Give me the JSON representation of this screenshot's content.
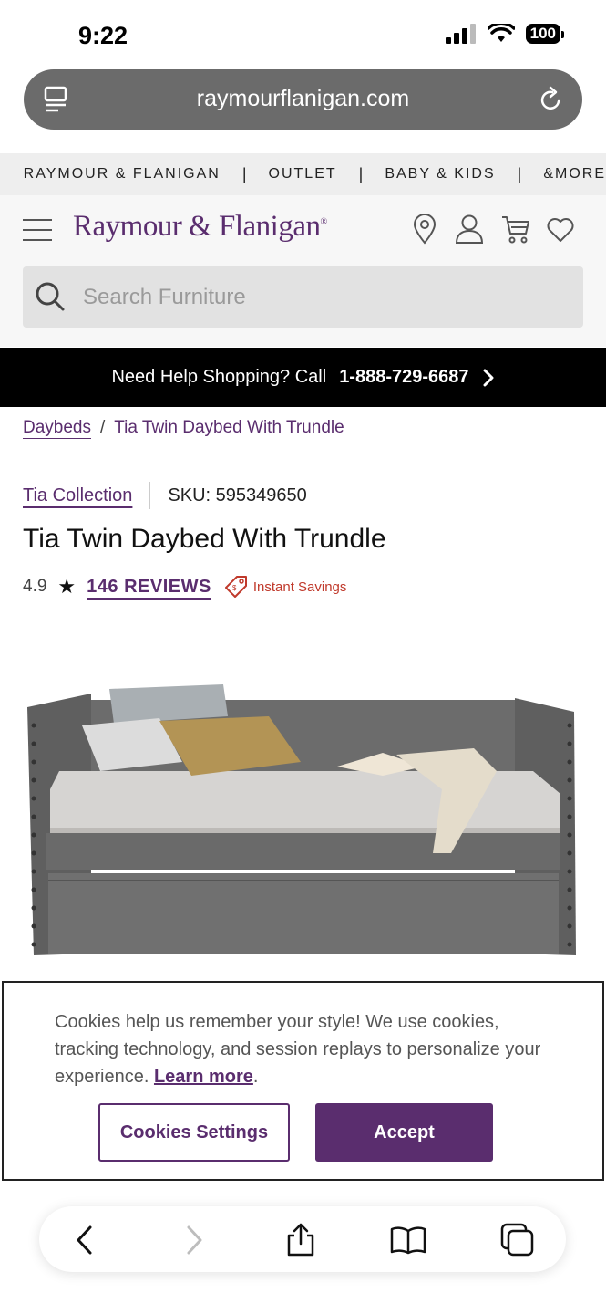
{
  "status_bar": {
    "time": "9:22",
    "battery": "100"
  },
  "browser": {
    "url": "raymourflanigan.com"
  },
  "top_nav": {
    "items": [
      "RAYMOUR & FLANIGAN",
      "OUTLET",
      "BABY & KIDS",
      "&MORE"
    ],
    "separator": "|"
  },
  "header": {
    "logo": "Raymour & Flanigan",
    "logo_mark": "®",
    "search_placeholder": "Search Furniture"
  },
  "help_banner": {
    "text": "Need Help Shopping? Call",
    "phone": "1-888-729-6687"
  },
  "breadcrumb": {
    "parent": "Daybeds",
    "separator": "/",
    "current": "Tia Twin Daybed With Trundle"
  },
  "product": {
    "collection": "Tia Collection",
    "sku": "SKU: 595349650",
    "title": "Tia Twin Daybed With Trundle",
    "rating": "4.9",
    "reviews": "146 REVIEWS",
    "savings": "Instant Savings"
  },
  "cookie": {
    "text": "Cookies help us remember your style! We use cookies, tracking technology, and session replays to personalize your experience.",
    "learn_more": "Learn more",
    "period": ".",
    "settings_button": "Cookies Settings",
    "accept_button": "Accept"
  },
  "colors": {
    "brand_purple": "#5a2d6e",
    "savings_red": "#c0392b",
    "banner_black": "#000000"
  },
  "icons": {
    "url_left": "reader-icon",
    "url_right": "reload-icon",
    "header": [
      "location-pin-icon",
      "account-icon",
      "cart-icon",
      "heart-icon"
    ],
    "toolbar": [
      "back-icon",
      "forward-icon",
      "share-icon",
      "bookmarks-icon",
      "tabs-icon"
    ]
  }
}
